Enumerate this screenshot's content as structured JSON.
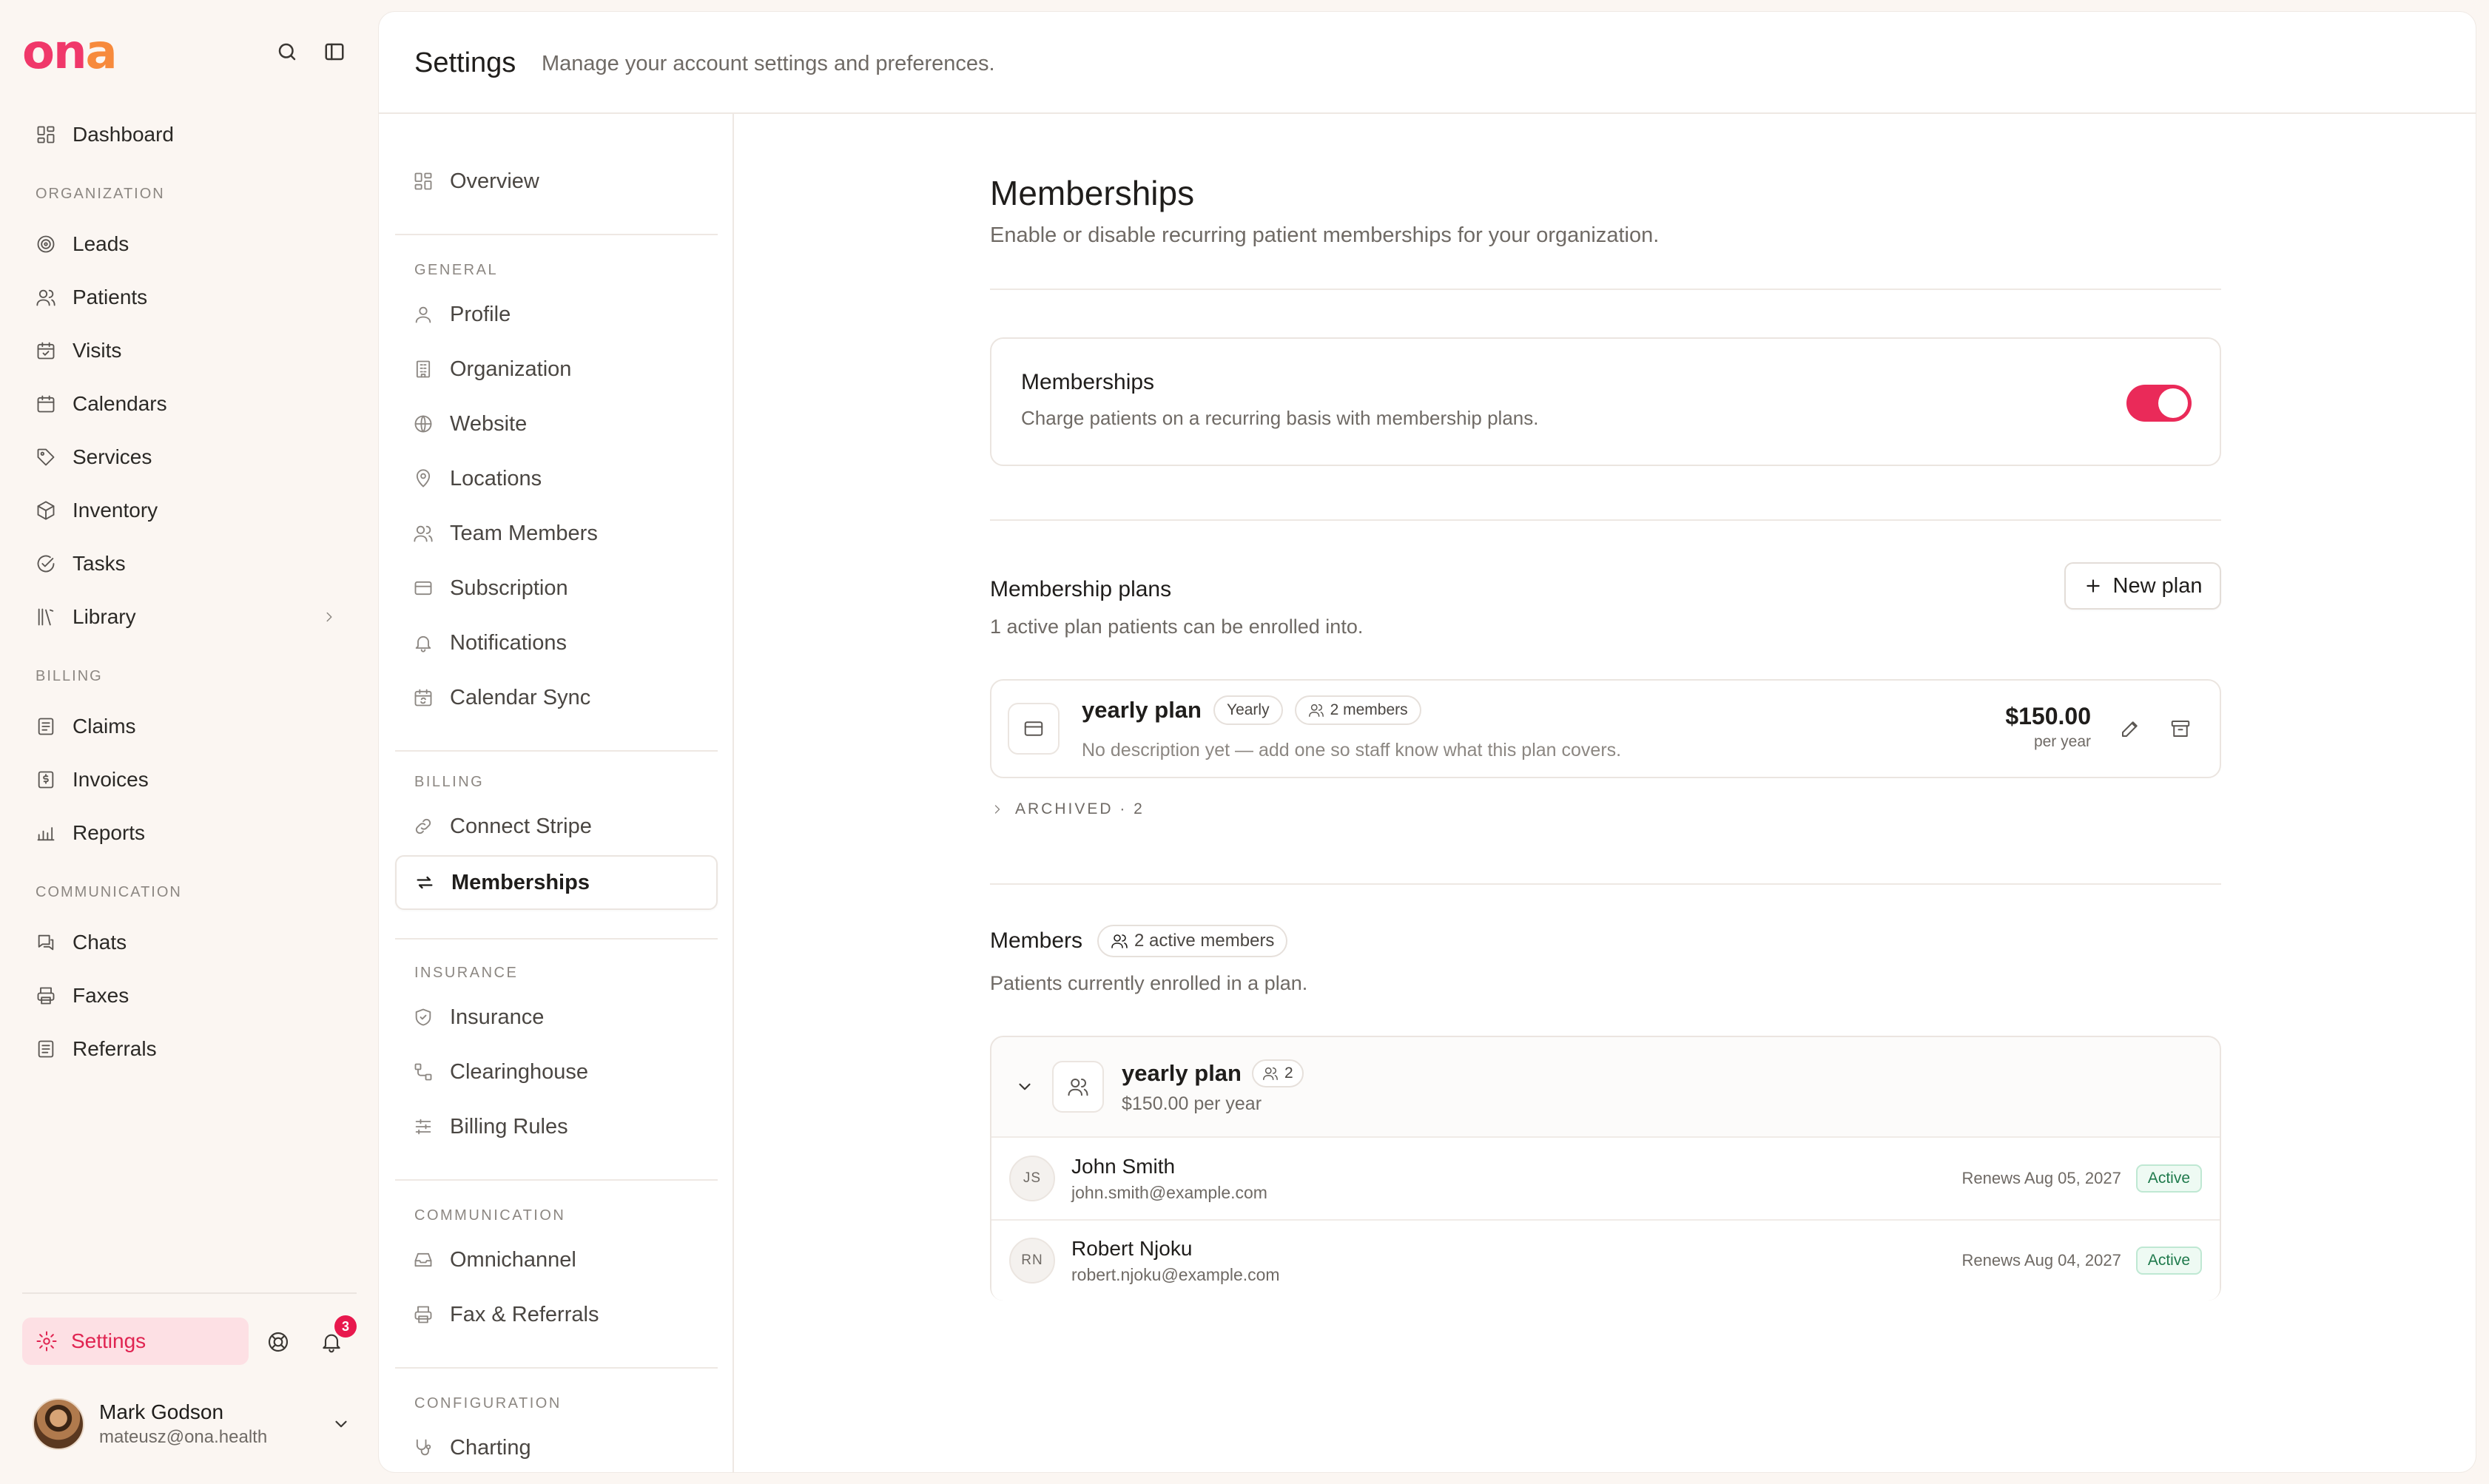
{
  "app": {
    "logo_main": "on",
    "logo_accent": "a"
  },
  "sidebar": {
    "dashboard": "Dashboard",
    "organization_header": "ORGANIZATION",
    "organization_items": [
      "Leads",
      "Patients",
      "Visits",
      "Calendars",
      "Services",
      "Inventory",
      "Tasks",
      "Library"
    ],
    "billing_header": "BILLING",
    "billing_items": [
      "Claims",
      "Invoices",
      "Reports"
    ],
    "communication_header": "COMMUNICATION",
    "communication_items": [
      "Chats",
      "Faxes",
      "Referrals"
    ],
    "settings_label": "Settings",
    "notification_count": "3",
    "user": {
      "name": "Mark Godson",
      "email": "mateusz@ona.health"
    }
  },
  "header": {
    "title": "Settings",
    "subtitle": "Manage your account settings and preferences."
  },
  "settings_nav": {
    "overview": "Overview",
    "general_header": "GENERAL",
    "general_items": [
      "Profile",
      "Organization",
      "Website",
      "Locations",
      "Team Members",
      "Subscription",
      "Notifications",
      "Calendar Sync"
    ],
    "billing_header": "BILLING",
    "billing_items": [
      "Connect Stripe",
      "Memberships"
    ],
    "insurance_header": "INSURANCE",
    "insurance_items": [
      "Insurance",
      "Clearinghouse",
      "Billing Rules"
    ],
    "communication_header": "COMMUNICATION",
    "communication_items": [
      "Omnichannel",
      "Fax & Referrals"
    ],
    "configuration_header": "CONFIGURATION",
    "configuration_items": [
      "Charting"
    ]
  },
  "content": {
    "title": "Memberships",
    "subtitle": "Enable or disable recurring patient memberships for your organization.",
    "toggle_card": {
      "title": "Memberships",
      "description": "Charge patients on a recurring basis with membership plans.",
      "enabled": true
    },
    "plans": {
      "title": "Membership plans",
      "subtitle": "1 active plan patients can be enrolled into.",
      "new_plan_label": "New plan",
      "plan": {
        "name": "yearly plan",
        "interval": "Yearly",
        "members_badge": "2 members",
        "description": "No description yet — add one so staff know what this plan covers.",
        "price": "$150.00",
        "price_period": "per year"
      },
      "archived_label": "ARCHIVED · 2"
    },
    "members": {
      "title": "Members",
      "badge": "2 active members",
      "subtitle": "Patients currently enrolled in a plan.",
      "group": {
        "plan_name": "yearly plan",
        "count": "2",
        "price_line": "$150.00 per year"
      },
      "rows": [
        {
          "initials": "JS",
          "name": "John Smith",
          "email": "john.smith@example.com",
          "renews": "Renews Aug 05, 2027",
          "status": "Active"
        },
        {
          "initials": "RN",
          "name": "Robert Njoku",
          "email": "robert.njoku@example.com",
          "renews": "Renews Aug 04, 2027",
          "status": "Active"
        }
      ]
    }
  },
  "colors": {
    "brand": "#f0386a",
    "accent": "#f78a3c",
    "toggle_on": "#ea2a59",
    "status_active": "#1f7a4c"
  }
}
